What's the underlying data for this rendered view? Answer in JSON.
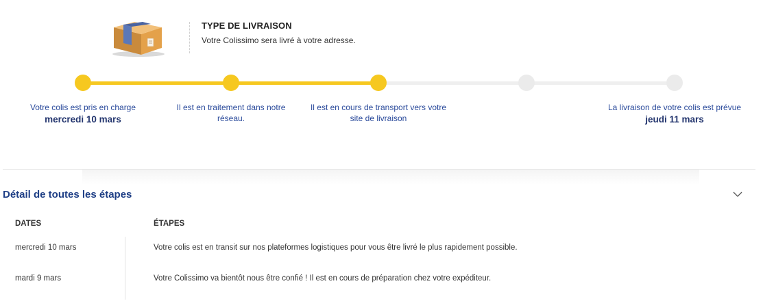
{
  "delivery": {
    "title": "TYPE DE LIVRAISON",
    "subtitle": "Votre Colissimo sera livré à votre adresse.",
    "icon": "package-box-icon"
  },
  "progress": {
    "completed_steps": 3,
    "total_steps": 5,
    "colors": {
      "done": "#f6c820",
      "todo": "#ebebeb"
    }
  },
  "steps": [
    {
      "text": "Votre colis est pris en charge",
      "date": "mercredi 10 mars",
      "state": "done"
    },
    {
      "text": "Il est en traitement dans notre réseau.",
      "date": "",
      "state": "done"
    },
    {
      "text": "Il est en cours de transport vers votre site de livraison",
      "date": "",
      "state": "done"
    },
    {
      "text": "",
      "date": "",
      "state": "todo"
    },
    {
      "text": "La livraison de votre colis est prévue",
      "date": "jeudi 11 mars",
      "state": "todo"
    }
  ],
  "details": {
    "title": "Détail de toutes les étapes",
    "toggle_icon": "chevron-down-icon",
    "headers": {
      "dates": "DATES",
      "steps": "ÉTAPES"
    },
    "rows": [
      {
        "date": "mercredi 10 mars",
        "step": "Votre colis est en transit sur nos plateformes logistiques pour vous être livré le plus rapidement possible."
      },
      {
        "date": "mardi 9 mars",
        "step": "Votre Colissimo va bientôt nous être confié ! Il est en cours de préparation chez votre expéditeur."
      }
    ]
  }
}
